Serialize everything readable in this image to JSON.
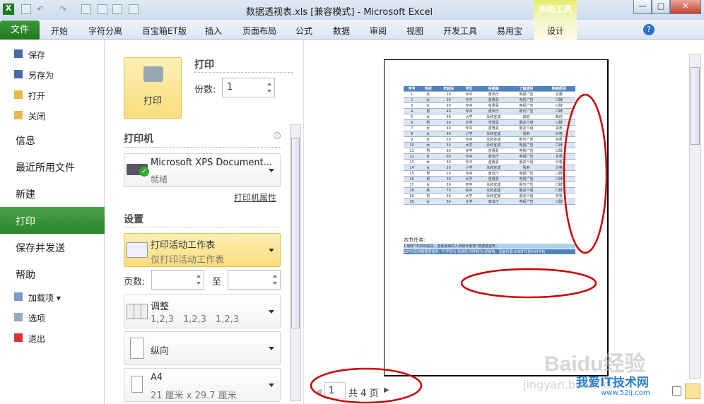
{
  "window": {
    "title": "数据透视表.xls  [兼容模式]  -  Microsoft Excel",
    "context_group": "表格工具",
    "min": "—",
    "max": "□",
    "close": "✕"
  },
  "ribbon_tabs": [
    "文件",
    "开始",
    "字符分离",
    "百宝箱ET版",
    "插入",
    "页面布局",
    "公式",
    "数据",
    "审阅",
    "视图",
    "开发工具",
    "易用宝",
    "设计"
  ],
  "nav": {
    "small_top": [
      "保存",
      "另存为",
      "打开",
      "关闭"
    ],
    "big": [
      "信息",
      "最近所用文件",
      "新建",
      "打印",
      "保存并发送",
      "帮助"
    ],
    "selected": "打印",
    "small_bottom": [
      "加载项",
      "选项",
      "退出"
    ]
  },
  "print": {
    "button": "打印",
    "heading": "打印",
    "copies_label": "份数:",
    "copies": "1"
  },
  "printer": {
    "heading": "打印机",
    "name": "Microsoft XPS Document...",
    "status": "就绪",
    "properties_link": "打印机属性"
  },
  "settings": {
    "heading": "设置",
    "scope_title": "打印活动工作表",
    "scope_sub": "仅打印活动工作表",
    "pages_label": "页数:",
    "to_label": "至",
    "pages_from": "",
    "pages_to": "",
    "collate_title": "调整",
    "collate_sub": [
      "1,2,3",
      "1,2,3",
      "1,2,3"
    ],
    "orientation": "纵向",
    "paper_title": "A4",
    "paper_sub": "21 厘米 x 29.7 厘米"
  },
  "preview": {
    "headers": [
      "序号",
      "性别",
      "年龄段",
      "学历",
      "经销商",
      "了解途径",
      "购物原因"
    ],
    "rows": [
      [
        "1",
        "女",
        "20",
        "专中",
        "废出厅",
        "电视广告",
        "实惠"
      ],
      [
        "2",
        "女",
        "20",
        "专中",
        "首惠县",
        "电视广告",
        "口碑"
      ],
      [
        "3",
        "女",
        "20",
        "专中",
        "首惠县",
        "电视广告",
        "口碑"
      ],
      [
        "4",
        "男",
        "40",
        "专中",
        "废出厅",
        "报刊广告",
        "口碑"
      ],
      [
        "5",
        "女",
        "40",
        "大学",
        "永和宣成",
        "其他",
        "其他"
      ],
      [
        "6",
        "男",
        "50",
        "大学",
        "凭恩恩",
        "朋友介绍",
        "口碑"
      ],
      [
        "7",
        "女",
        "40",
        "专中",
        "首惠县",
        "朋友介绍",
        "实惠"
      ],
      [
        "8",
        "女",
        "50",
        "小学",
        "永和宣成",
        "看到",
        "价格"
      ],
      [
        "9",
        "女",
        "50",
        "专中",
        "永和宣成",
        "报刊广告",
        "实惠"
      ],
      [
        "10",
        "女",
        "50",
        "大学",
        "永和宣成",
        "电视广告",
        "口碑"
      ],
      [
        "11",
        "男",
        "50",
        "专中",
        "首惠县",
        "电视广告",
        "口碑"
      ],
      [
        "12",
        "女",
        "60",
        "专中",
        "废出厅",
        "电视广告",
        "实惠"
      ],
      [
        "13",
        "女",
        "60",
        "专中",
        "首惠县",
        "朋友介绍",
        "价格"
      ],
      [
        "14",
        "女",
        "50",
        "小学",
        "永和宣成",
        "看到",
        "价格"
      ],
      [
        "15",
        "男",
        "20",
        "专中",
        "废出厅",
        "电视广告",
        "口碑"
      ],
      [
        "16",
        "男",
        "30",
        "大学",
        "首惠县",
        "电视广告",
        "口碑"
      ],
      [
        "17",
        "女",
        "50",
        "初中",
        "永和宣成",
        "报刊广告",
        "口碑"
      ],
      [
        "18",
        "男",
        "70",
        "初中",
        "永和宣成",
        "朋友介绍",
        "口碑"
      ],
      [
        "19",
        "男",
        "50",
        "大学",
        "永和宣成",
        "朋友介绍",
        "实惠"
      ],
      [
        "20",
        "女",
        "50",
        "大学",
        "废出厅",
        "电视广告",
        "口碑"
      ]
    ],
    "task_title": "本节任务:",
    "task_lines": [
      "1.制作“不同年龄段、各经销商的人员统计报表”数据透视表。",
      "以P55页的数据透视表，行字段为:年龄段;列字段为:经销商，页面位置:SHEET1的A30开始"
    ],
    "page_current": "1",
    "page_total_label": "共 4 页"
  },
  "watermark": {
    "text1": "Baidu经验",
    "text2": "jingyan.baidu.com",
    "text3": "我爱IT技术网",
    "text4": "www.52ij.com"
  },
  "colors": {
    "file_tab": "#2a862a",
    "highlight": "#f9dd7d",
    "annotation": "#c00000",
    "table_header": "#4f81bd"
  }
}
